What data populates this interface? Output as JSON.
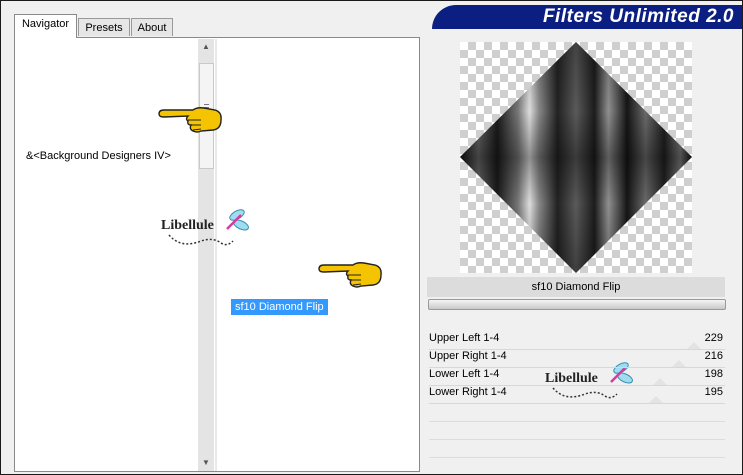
{
  "window": {
    "title": "Filters Unlimited 2.0"
  },
  "tabs": [
    {
      "label": "Navigator",
      "active": true
    },
    {
      "label": "Presets",
      "active": false
    },
    {
      "label": "About",
      "active": false
    }
  ],
  "navigator": {
    "selected_category": "&<Background Designers IV>",
    "selected_filter": "sf10 Diamond Flip"
  },
  "preview": {
    "filter_name": "sf10 Diamond Flip"
  },
  "parameters": [
    {
      "label": "Upper Left 1-4",
      "value": "229"
    },
    {
      "label": "Upper Right 1-4",
      "value": "216"
    },
    {
      "label": "Lower Left 1-4",
      "value": "198"
    },
    {
      "label": "Lower Right 1-4",
      "value": "195"
    }
  ],
  "watermark": {
    "text": "Libellule"
  },
  "colors": {
    "title_bar": "#0b1f83",
    "selection": "#3399ff",
    "pointer_hand": "#f5c400"
  }
}
